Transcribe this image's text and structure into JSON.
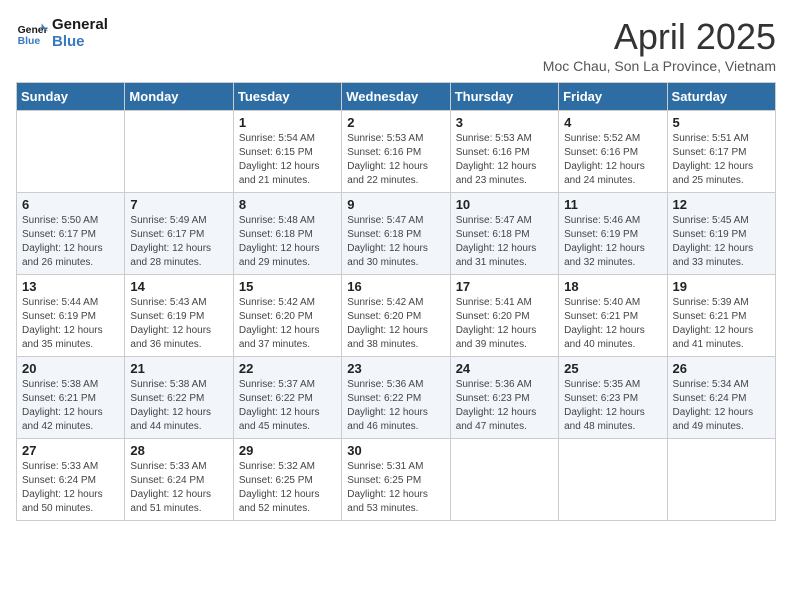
{
  "logo": {
    "line1": "General",
    "line2": "Blue"
  },
  "title": "April 2025",
  "subtitle": "Moc Chau, Son La Province, Vietnam",
  "weekdays": [
    "Sunday",
    "Monday",
    "Tuesday",
    "Wednesday",
    "Thursday",
    "Friday",
    "Saturday"
  ],
  "weeks": [
    [
      {
        "day": "",
        "info": ""
      },
      {
        "day": "",
        "info": ""
      },
      {
        "day": "1",
        "info": "Sunrise: 5:54 AM\nSunset: 6:15 PM\nDaylight: 12 hours and 21 minutes."
      },
      {
        "day": "2",
        "info": "Sunrise: 5:53 AM\nSunset: 6:16 PM\nDaylight: 12 hours and 22 minutes."
      },
      {
        "day": "3",
        "info": "Sunrise: 5:53 AM\nSunset: 6:16 PM\nDaylight: 12 hours and 23 minutes."
      },
      {
        "day": "4",
        "info": "Sunrise: 5:52 AM\nSunset: 6:16 PM\nDaylight: 12 hours and 24 minutes."
      },
      {
        "day": "5",
        "info": "Sunrise: 5:51 AM\nSunset: 6:17 PM\nDaylight: 12 hours and 25 minutes."
      }
    ],
    [
      {
        "day": "6",
        "info": "Sunrise: 5:50 AM\nSunset: 6:17 PM\nDaylight: 12 hours and 26 minutes."
      },
      {
        "day": "7",
        "info": "Sunrise: 5:49 AM\nSunset: 6:17 PM\nDaylight: 12 hours and 28 minutes."
      },
      {
        "day": "8",
        "info": "Sunrise: 5:48 AM\nSunset: 6:18 PM\nDaylight: 12 hours and 29 minutes."
      },
      {
        "day": "9",
        "info": "Sunrise: 5:47 AM\nSunset: 6:18 PM\nDaylight: 12 hours and 30 minutes."
      },
      {
        "day": "10",
        "info": "Sunrise: 5:47 AM\nSunset: 6:18 PM\nDaylight: 12 hours and 31 minutes."
      },
      {
        "day": "11",
        "info": "Sunrise: 5:46 AM\nSunset: 6:19 PM\nDaylight: 12 hours and 32 minutes."
      },
      {
        "day": "12",
        "info": "Sunrise: 5:45 AM\nSunset: 6:19 PM\nDaylight: 12 hours and 33 minutes."
      }
    ],
    [
      {
        "day": "13",
        "info": "Sunrise: 5:44 AM\nSunset: 6:19 PM\nDaylight: 12 hours and 35 minutes."
      },
      {
        "day": "14",
        "info": "Sunrise: 5:43 AM\nSunset: 6:19 PM\nDaylight: 12 hours and 36 minutes."
      },
      {
        "day": "15",
        "info": "Sunrise: 5:42 AM\nSunset: 6:20 PM\nDaylight: 12 hours and 37 minutes."
      },
      {
        "day": "16",
        "info": "Sunrise: 5:42 AM\nSunset: 6:20 PM\nDaylight: 12 hours and 38 minutes."
      },
      {
        "day": "17",
        "info": "Sunrise: 5:41 AM\nSunset: 6:20 PM\nDaylight: 12 hours and 39 minutes."
      },
      {
        "day": "18",
        "info": "Sunrise: 5:40 AM\nSunset: 6:21 PM\nDaylight: 12 hours and 40 minutes."
      },
      {
        "day": "19",
        "info": "Sunrise: 5:39 AM\nSunset: 6:21 PM\nDaylight: 12 hours and 41 minutes."
      }
    ],
    [
      {
        "day": "20",
        "info": "Sunrise: 5:38 AM\nSunset: 6:21 PM\nDaylight: 12 hours and 42 minutes."
      },
      {
        "day": "21",
        "info": "Sunrise: 5:38 AM\nSunset: 6:22 PM\nDaylight: 12 hours and 44 minutes."
      },
      {
        "day": "22",
        "info": "Sunrise: 5:37 AM\nSunset: 6:22 PM\nDaylight: 12 hours and 45 minutes."
      },
      {
        "day": "23",
        "info": "Sunrise: 5:36 AM\nSunset: 6:22 PM\nDaylight: 12 hours and 46 minutes."
      },
      {
        "day": "24",
        "info": "Sunrise: 5:36 AM\nSunset: 6:23 PM\nDaylight: 12 hours and 47 minutes."
      },
      {
        "day": "25",
        "info": "Sunrise: 5:35 AM\nSunset: 6:23 PM\nDaylight: 12 hours and 48 minutes."
      },
      {
        "day": "26",
        "info": "Sunrise: 5:34 AM\nSunset: 6:24 PM\nDaylight: 12 hours and 49 minutes."
      }
    ],
    [
      {
        "day": "27",
        "info": "Sunrise: 5:33 AM\nSunset: 6:24 PM\nDaylight: 12 hours and 50 minutes."
      },
      {
        "day": "28",
        "info": "Sunrise: 5:33 AM\nSunset: 6:24 PM\nDaylight: 12 hours and 51 minutes."
      },
      {
        "day": "29",
        "info": "Sunrise: 5:32 AM\nSunset: 6:25 PM\nDaylight: 12 hours and 52 minutes."
      },
      {
        "day": "30",
        "info": "Sunrise: 5:31 AM\nSunset: 6:25 PM\nDaylight: 12 hours and 53 minutes."
      },
      {
        "day": "",
        "info": ""
      },
      {
        "day": "",
        "info": ""
      },
      {
        "day": "",
        "info": ""
      }
    ]
  ]
}
